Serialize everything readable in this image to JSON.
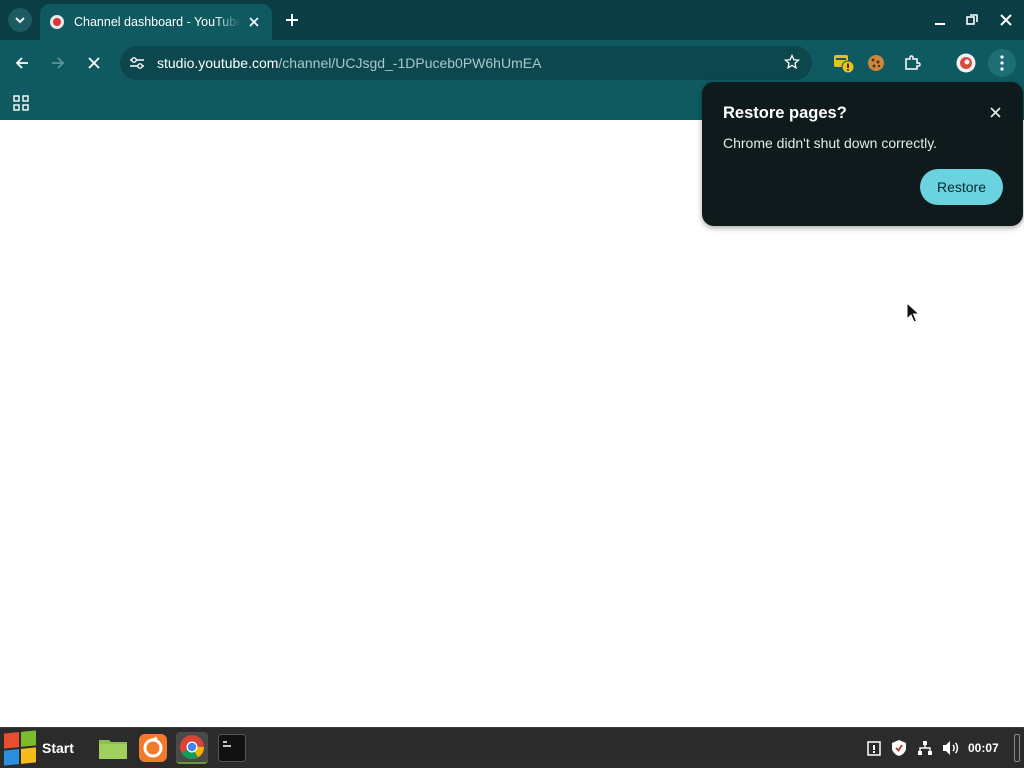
{
  "browser": {
    "tab": {
      "title": "Channel dashboard - YouTube Studio",
      "favicon": "youtube-studio-icon"
    },
    "url": {
      "host": "studio.youtube.com",
      "path": "/channel/UCJsgd_-1DPuceb0PW6hUmEA"
    },
    "theme_colors": {
      "tab_strip": "#0b3d44",
      "toolbar": "#0f5a60",
      "accent": "#6ad3df"
    }
  },
  "restore_bubble": {
    "title": "Restore pages?",
    "message": "Chrome didn't shut down correctly.",
    "button_label": "Restore"
  },
  "taskbar": {
    "start_label": "Start",
    "clock": "00:07",
    "apps": [
      "file-manager-icon",
      "firefox-icon",
      "chrome-icon",
      "terminal-icon"
    ],
    "tray": [
      "clipboard-icon",
      "shield-icon",
      "network-icon",
      "volume-icon"
    ]
  }
}
